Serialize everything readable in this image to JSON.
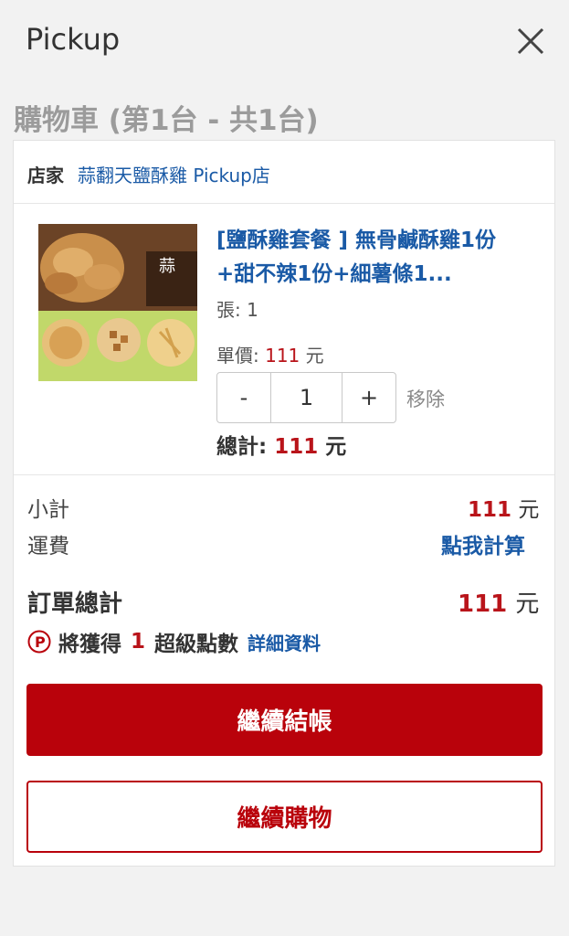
{
  "header": {
    "title": "Pickup",
    "close_icon": "close-icon"
  },
  "cart": {
    "title": "購物車 (第1台 - 共1台)"
  },
  "store": {
    "label": "店家",
    "name": "蒜翻天鹽酥雞 Pickup店"
  },
  "item": {
    "name": "[鹽酥雞套餐 ] 無骨鹹酥雞1份+甜不辣1份+細薯條1...",
    "qty_note": "張: 1",
    "unit_price_label": "單價:",
    "unit_price_value": "111",
    "unit_price_currency": "元",
    "qty_minus": "-",
    "qty_value": "1",
    "qty_plus": "+",
    "remove_label": "移除",
    "total_label": "總計:",
    "total_value": "111",
    "total_currency": "元",
    "image_text": "蒜"
  },
  "summary": {
    "subtotal_label": "小計",
    "subtotal_value": "111",
    "subtotal_currency": "元",
    "shipping_label": "運費",
    "shipping_value": "點我計算",
    "order_total_label": "訂單總計",
    "order_total_value": "111",
    "order_total_currency": "元"
  },
  "points": {
    "icon": "points-p-icon",
    "prefix": "將獲得",
    "amount": "1",
    "suffix": "超級點數",
    "detail_link": "詳細資料"
  },
  "buttons": {
    "checkout": "繼續結帳",
    "continue_shopping": "繼續購物"
  },
  "colors": {
    "accent_red": "#b9020b",
    "price_red": "#b9141a",
    "link_blue": "#1a5aa6",
    "muted_gray": "#9b9b9b"
  }
}
